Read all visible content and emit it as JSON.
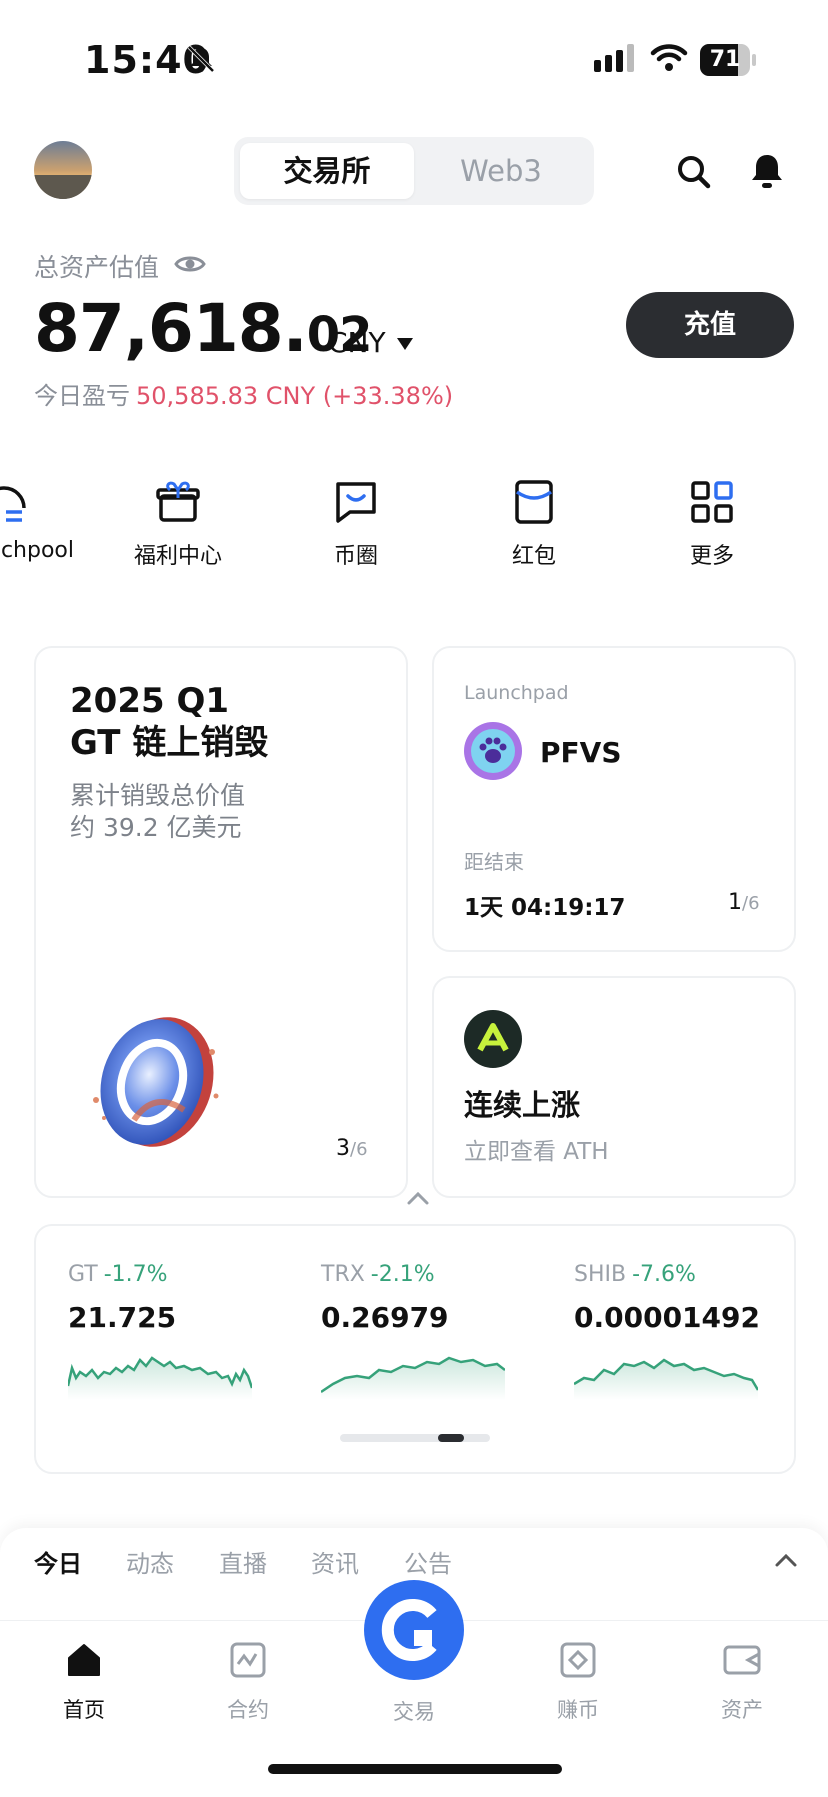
{
  "status_bar": {
    "time": "15:40",
    "battery": "71"
  },
  "header": {
    "tabs": [
      "交易所",
      "Web3"
    ],
    "active_tab": 0
  },
  "assets": {
    "label": "总资产估值",
    "amount_int": "87,618.",
    "amount_dec": "02",
    "currency": "CNY",
    "deposit_label": "充值",
    "pnl_label": "今日盈亏",
    "pnl_value": "50,585.83 CNY (+33.38%)"
  },
  "shortcuts": [
    {
      "label": "chpool",
      "icon": "launchpool-icon"
    },
    {
      "label": "福利中心",
      "icon": "gift-icon"
    },
    {
      "label": "币圈",
      "icon": "chat-icon"
    },
    {
      "label": "红包",
      "icon": "red-envelope-icon"
    },
    {
      "label": "更多",
      "icon": "grid-icon"
    }
  ],
  "banner_card": {
    "title_line1": "2025 Q1",
    "title_line2": "GT 链上销毁",
    "sub_line1": "累计销毁总价值",
    "sub_line2": "约 39.2 亿美元",
    "page": "3",
    "total": "/6"
  },
  "launchpad_card": {
    "tag": "Launchpad",
    "token": "PFVS",
    "end_label": "距结束",
    "countdown": "1天 04:19:17",
    "page": "1",
    "total": "/6"
  },
  "ath_card": {
    "title": "连续上涨",
    "subtitle": "立即查看 ATH"
  },
  "tickers": [
    {
      "symbol": "GT",
      "change": "-1.7%",
      "price": "21.725"
    },
    {
      "symbol": "TRX",
      "change": "-2.1%",
      "price": "0.26979"
    },
    {
      "symbol": "SHIB",
      "change": "-7.6%",
      "price": "0.00001492"
    }
  ],
  "feed_tabs": [
    "今日",
    "动态",
    "直播",
    "资讯",
    "公告"
  ],
  "bottom_nav": [
    {
      "label": "首页",
      "icon": "home-icon"
    },
    {
      "label": "合约",
      "icon": "futures-icon"
    },
    {
      "label": "交易",
      "icon": "trade-icon"
    },
    {
      "label": "赚币",
      "icon": "earn-icon"
    },
    {
      "label": "资产",
      "icon": "wallet-icon"
    }
  ],
  "colors": {
    "accent": "#2e6ef0",
    "loss": "#e0526a",
    "gain_chart": "#36a27a",
    "dark_button": "#2b2d31"
  }
}
